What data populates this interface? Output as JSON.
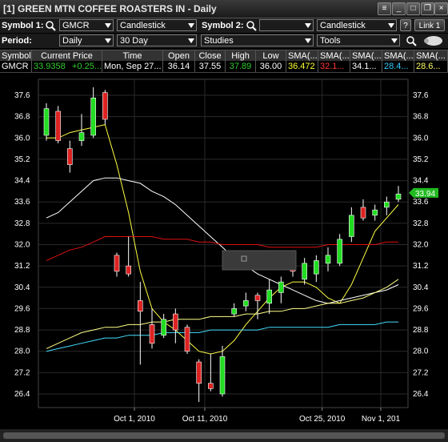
{
  "window": {
    "title": "[1] GREEN MTN COFFEE ROASTERS IN - Daily"
  },
  "toolbar1": {
    "symbol1_label": "Symbol 1:",
    "symbol1_value": "GMCR",
    "chart_style": "Candlestick",
    "symbol2_label": "Symbol 2:",
    "symbol2_value": "",
    "chart_style2": "Candlestick",
    "help": "?",
    "link": "Link 1"
  },
  "toolbar2": {
    "period_label": "Period:",
    "period_value": "Daily",
    "range_value": "30 Day",
    "studies_value": "Studies",
    "tools_value": "Tools"
  },
  "quote": {
    "headers": [
      "Symbol",
      "Current Price",
      "Time",
      "Open",
      "Close",
      "High",
      "Low",
      "SMA(...",
      "SMA(...",
      "SMA(...",
      "SMA(...",
      "SMA(..."
    ],
    "values": [
      "GMCR",
      "33.9358",
      "+0.25...",
      "Mon, Sep 27...",
      "36.14",
      "37.55",
      "37.89",
      "36.00",
      "36.472",
      "32.1...",
      "34.1...",
      "28.4...",
      "28.6..."
    ],
    "colors": {
      "price": "#33cc33",
      "high": "#33cc33",
      "sma1": "#ffff33",
      "sma2": "#ff3333",
      "sma3": "#ffffff",
      "sma4": "#33ccff",
      "sma5": "#ffff66"
    }
  },
  "chart_data": {
    "type": "candlestick",
    "ylim": [
      26.0,
      38.0
    ],
    "yticks": [
      37.6,
      36.8,
      36.0,
      35.2,
      34.4,
      33.6,
      32.8,
      32.0,
      31.2,
      30.4,
      29.6,
      28.8,
      28.0,
      27.2,
      26.4
    ],
    "xticks": [
      "Oct 1, 2010",
      "Oct 11, 2010",
      "Oct 25, 2010",
      "Nov 1, 201"
    ],
    "xtick_index": [
      7.5,
      13.5,
      23.5,
      28.5
    ],
    "last_price_label": "33.94",
    "colors": {
      "up": "#22dd22",
      "down": "#dd2222",
      "sma_white": "#ffffff",
      "sma_red": "#dd1111",
      "sma_yellow": "#ffff44",
      "sma_cyan": "#44ddff",
      "sma_yellow2": "#ffff88"
    },
    "candles": [
      {
        "o": 36.1,
        "c": 37.1,
        "h": 37.3,
        "l": 35.9
      },
      {
        "o": 37.0,
        "c": 35.9,
        "h": 37.2,
        "l": 35.8
      },
      {
        "o": 35.6,
        "c": 35.0,
        "h": 35.9,
        "l": 34.7
      },
      {
        "o": 35.9,
        "c": 36.2,
        "h": 36.9,
        "l": 35.7
      },
      {
        "o": 36.1,
        "c": 37.5,
        "h": 37.9,
        "l": 36.0
      },
      {
        "o": 37.7,
        "c": 36.7,
        "h": 37.8,
        "l": 36.5
      },
      {
        "o": 31.6,
        "c": 31.0,
        "h": 31.7,
        "l": 30.8
      },
      {
        "o": 31.2,
        "c": 30.9,
        "h": 32.3,
        "l": 30.8
      },
      {
        "o": 29.9,
        "c": 29.5,
        "h": 30.6,
        "l": 27.5
      },
      {
        "o": 29.0,
        "c": 28.3,
        "h": 29.6,
        "l": 28.1
      },
      {
        "o": 28.6,
        "c": 29.2,
        "h": 29.4,
        "l": 28.5
      },
      {
        "o": 29.4,
        "c": 28.8,
        "h": 29.6,
        "l": 28.3
      },
      {
        "o": 28.9,
        "c": 28.0,
        "h": 29.0,
        "l": 27.9
      },
      {
        "o": 27.6,
        "c": 26.8,
        "h": 27.7,
        "l": 26.1
      },
      {
        "o": 26.8,
        "c": 26.6,
        "h": 27.9,
        "l": 26.5
      },
      {
        "o": 26.4,
        "c": 27.8,
        "h": 28.2,
        "l": 26.3
      },
      {
        "o": 29.4,
        "c": 29.6,
        "h": 29.8,
        "l": 29.3
      },
      {
        "o": 29.7,
        "c": 29.9,
        "h": 30.2,
        "l": 29.5
      },
      {
        "o": 30.1,
        "c": 29.9,
        "h": 30.2,
        "l": 29.2
      },
      {
        "o": 29.8,
        "c": 30.3,
        "h": 30.7,
        "l": 29.4
      },
      {
        "o": 30.2,
        "c": 30.6,
        "h": 30.8,
        "l": 29.8
      },
      {
        "o": 31.1,
        "c": 31.0,
        "h": 31.6,
        "l": 30.8
      },
      {
        "o": 30.7,
        "c": 31.3,
        "h": 31.5,
        "l": 30.5
      },
      {
        "o": 30.9,
        "c": 31.4,
        "h": 31.6,
        "l": 30.6
      },
      {
        "o": 31.3,
        "c": 31.6,
        "h": 31.9,
        "l": 31.0
      },
      {
        "o": 31.3,
        "c": 32.2,
        "h": 32.4,
        "l": 31.2
      },
      {
        "o": 32.3,
        "c": 33.1,
        "h": 33.4,
        "l": 32.1
      },
      {
        "o": 33.4,
        "c": 33.0,
        "h": 33.7,
        "l": 32.9
      },
      {
        "o": 33.1,
        "c": 33.3,
        "h": 33.5,
        "l": 32.9
      },
      {
        "o": 33.4,
        "c": 33.6,
        "h": 33.8,
        "l": 33.1
      },
      {
        "o": 33.7,
        "c": 33.9,
        "h": 34.2,
        "l": 33.6
      }
    ],
    "series": [
      {
        "color": "#ffff44",
        "values": [
          36.0,
          36.0,
          36.2,
          36.3,
          36.4,
          36.5,
          35.0,
          33.2,
          31.0,
          29.6,
          29.1,
          28.8,
          28.4,
          28.0,
          27.9,
          28.0,
          28.4,
          29.0,
          29.5,
          30.0,
          30.4,
          30.6,
          30.6,
          30.4,
          30.0,
          29.8,
          30.5,
          31.5,
          32.5,
          33.0,
          33.5
        ]
      },
      {
        "color": "#ffffff",
        "values": [
          33.0,
          33.2,
          33.6,
          34.0,
          34.4,
          34.5,
          34.5,
          34.4,
          34.3,
          34.0,
          33.8,
          33.5,
          33.1,
          32.7,
          32.3,
          31.9,
          31.5,
          31.2,
          30.9,
          30.7,
          30.5,
          30.3,
          30.1,
          29.9,
          29.8,
          29.9,
          30.0,
          30.1,
          30.2,
          30.3,
          30.5
        ]
      },
      {
        "color": "#dd1111",
        "values": [
          31.4,
          31.6,
          31.8,
          31.9,
          32.1,
          32.3,
          32.3,
          32.3,
          32.3,
          32.3,
          32.2,
          32.2,
          32.2,
          32.1,
          32.1,
          32.0,
          32.0,
          32.0,
          32.0,
          31.9,
          31.9,
          31.9,
          31.9,
          31.9,
          32.0,
          32.0,
          32.0,
          32.0,
          32.0,
          32.1,
          32.1
        ]
      },
      {
        "color": "#ffff88",
        "values": [
          28.1,
          28.3,
          28.5,
          28.7,
          28.8,
          28.9,
          28.9,
          29.0,
          29.0,
          29.1,
          29.1,
          29.2,
          29.2,
          29.2,
          29.3,
          29.3,
          29.3,
          29.4,
          29.4,
          29.5,
          29.5,
          29.6,
          29.6,
          29.7,
          29.8,
          29.8,
          29.9,
          30.0,
          30.2,
          30.4,
          30.7
        ]
      },
      {
        "color": "#44ddff",
        "values": [
          28.0,
          28.1,
          28.2,
          28.3,
          28.4,
          28.5,
          28.5,
          28.6,
          28.6,
          28.6,
          28.7,
          28.7,
          28.7,
          28.7,
          28.8,
          28.8,
          28.8,
          28.8,
          28.8,
          28.9,
          28.9,
          28.9,
          28.9,
          28.9,
          28.9,
          29.0,
          29.0,
          29.0,
          29.0,
          29.1,
          29.1
        ]
      }
    ]
  }
}
